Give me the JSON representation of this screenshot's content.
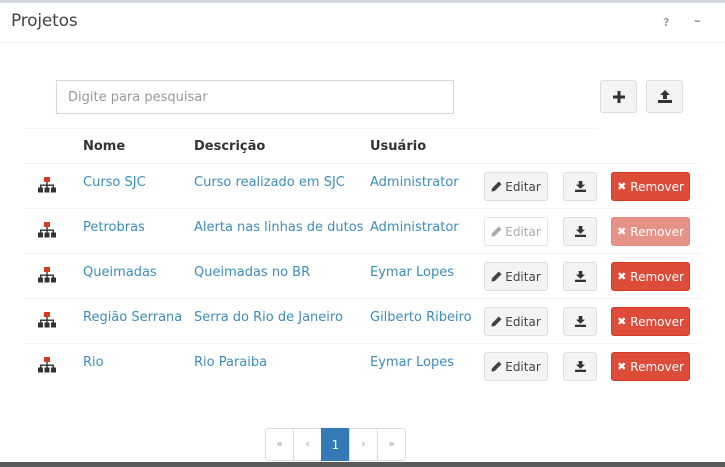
{
  "panel": {
    "title": "Projetos",
    "help_label": "?",
    "minimize_label": "–"
  },
  "search": {
    "placeholder": "Digite para pesquisar",
    "value": ""
  },
  "toolbar": {
    "add_icon": "plus-icon",
    "upload_icon": "upload-icon"
  },
  "table": {
    "headers": {
      "nome": "Nome",
      "descricao": "Descrição",
      "usuario": "Usuário"
    },
    "rows": [
      {
        "nome": "Curso SJC",
        "descricao": "Curso realizado em SJC",
        "usuario": "Administrator",
        "editar": "Editar",
        "remover": "Remover",
        "disabled": false
      },
      {
        "nome": "Petrobras",
        "descricao": "Alerta nas linhas de dutos",
        "usuario": "Administrator",
        "editar": "Editar",
        "remover": "Remover",
        "disabled": true
      },
      {
        "nome": "Queimadas",
        "descricao": "Queimadas no BR",
        "usuario": "Eymar Lopes",
        "editar": "Editar",
        "remover": "Remover",
        "disabled": false
      },
      {
        "nome": "Região Serrana",
        "descricao": "Serra do Rio de Janeiro",
        "usuario": "Gilberto Ribeiro",
        "editar": "Editar",
        "remover": "Remover",
        "disabled": false
      },
      {
        "nome": "Rio",
        "descricao": "Rio Paraiba",
        "usuario": "Eymar Lopes",
        "editar": "Editar",
        "remover": "Remover",
        "disabled": false
      }
    ]
  },
  "pagination": {
    "first": "«",
    "prev": "‹",
    "current": "1",
    "next": "›",
    "last": "»"
  },
  "colors": {
    "link": "#3c8dbc",
    "danger": "#dd4b39",
    "primary": "#337ab7"
  }
}
